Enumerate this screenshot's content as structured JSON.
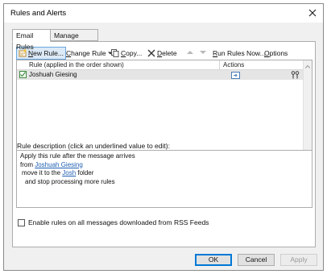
{
  "window": {
    "title": "Rules and Alerts"
  },
  "tabs": [
    {
      "label": "Email Rules",
      "active": true
    },
    {
      "label": "Manage Alerts",
      "active": false
    }
  ],
  "toolbar": {
    "new_rule_prefix": "N",
    "new_rule_rest": "ew Rule...",
    "change_rule_prefix": "C",
    "change_rule_rest": "hange Rule",
    "copy_prefix": "C",
    "copy_rest": "opy...",
    "delete_prefix": "D",
    "delete_rest": "elete",
    "run_rules_prefix": "R",
    "run_rules_rest": "un Rules Now...",
    "options_prefix": "O",
    "options_rest": "ptions"
  },
  "rules_list": {
    "columns": [
      "Rule (applied in the order shown)",
      "Actions"
    ],
    "rows": [
      {
        "name": "Joshuah Giesing",
        "enabled": true
      }
    ]
  },
  "description": {
    "label": "Rule description (click an underlined value to edit):",
    "line1": "Apply this rule after the message arrives",
    "line2_prefix": "from ",
    "line2_link": "Joshuah Giesing",
    "line3_prefix": "move it to the ",
    "line3_link": "Josh",
    "line3_suffix": " folder",
    "line4": "and stop processing more rules"
  },
  "rss_option": {
    "label": "Enable rules on all messages downloaded from RSS Feeds",
    "checked": false
  },
  "buttons": {
    "ok": "OK",
    "cancel": "Cancel",
    "apply": "Apply"
  },
  "colors": {
    "accent": "#0078d7",
    "link": "#1f5fb3",
    "check": "#3c8a3c"
  }
}
